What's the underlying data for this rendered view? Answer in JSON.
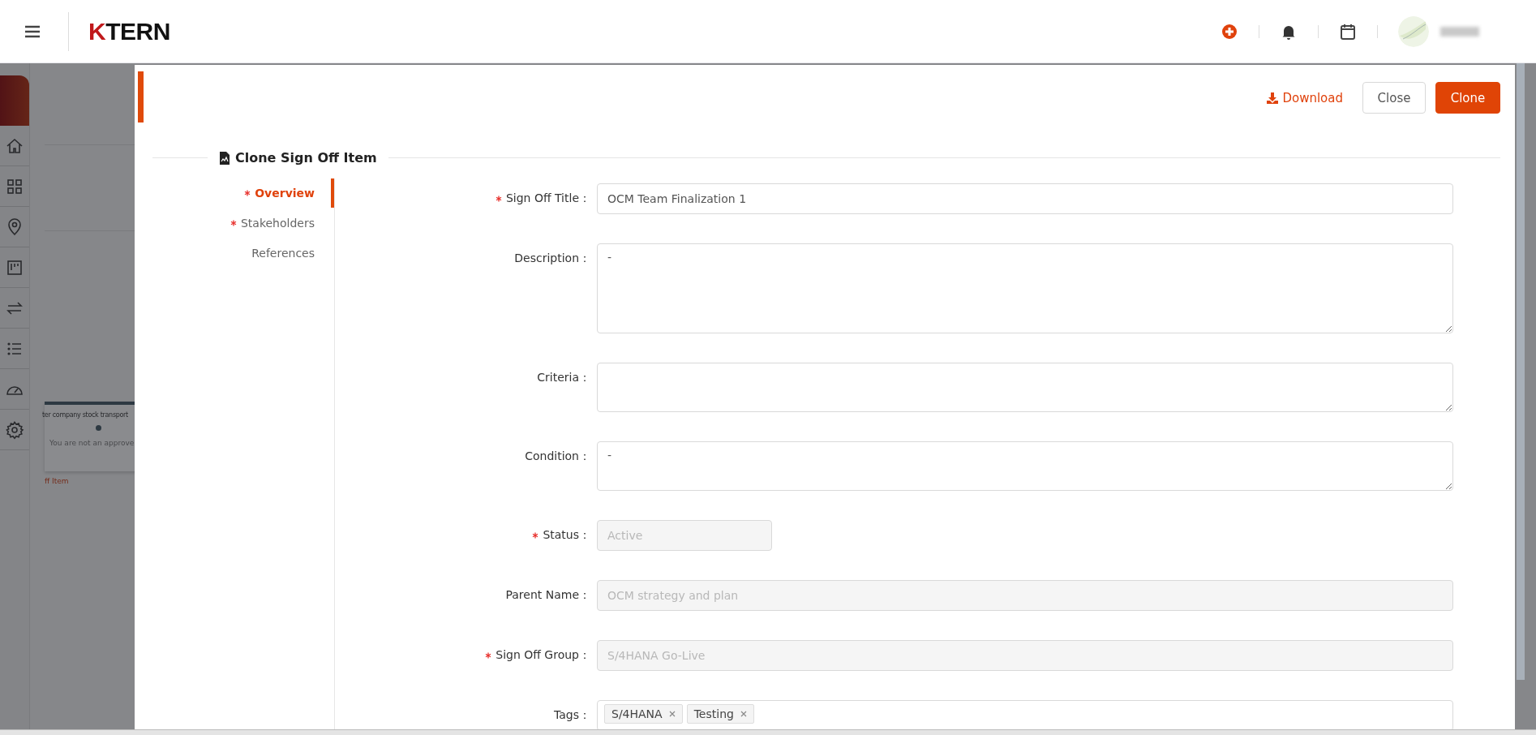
{
  "header": {
    "logo": "KTERN"
  },
  "background_page": {
    "card_title": "ter company stock transport",
    "card_note": "You are not an approve",
    "link": "ff Item"
  },
  "drawer": {
    "actions": {
      "download": "Download",
      "close": "Close",
      "clone": "Clone"
    },
    "title": "Clone Sign Off Item",
    "sections": [
      {
        "label": "Overview",
        "required": true,
        "selected": true
      },
      {
        "label": "Stakeholders",
        "required": true,
        "selected": false
      },
      {
        "label": "References",
        "required": false,
        "selected": false
      }
    ],
    "fields": [
      {
        "kind": "input",
        "label": "Sign Off Title：",
        "required": true,
        "disabled": false,
        "value": "OCM Team Finalization 1"
      },
      {
        "kind": "textarea",
        "label": "Description：",
        "required": false,
        "value": "-"
      },
      {
        "kind": "textarea",
        "label": "Criteria：",
        "required": false
      },
      {
        "kind": "textarea",
        "label": "Condition：",
        "required": false,
        "value": "-"
      },
      {
        "kind": "short-input",
        "label": "Status：",
        "required": true,
        "disabled": true,
        "value": "Active"
      },
      {
        "kind": "input",
        "label": "Parent Name：",
        "required": false,
        "disabled": true,
        "value": "OCM strategy and plan"
      },
      {
        "kind": "input",
        "label": "Sign Off Group：",
        "required": true,
        "disabled": true,
        "value": "S/4HANA Go-Live"
      },
      {
        "kind": "tags",
        "label": "Tags：",
        "required": false,
        "tags": [
          "S/4HANA",
          "Testing"
        ]
      }
    ]
  }
}
